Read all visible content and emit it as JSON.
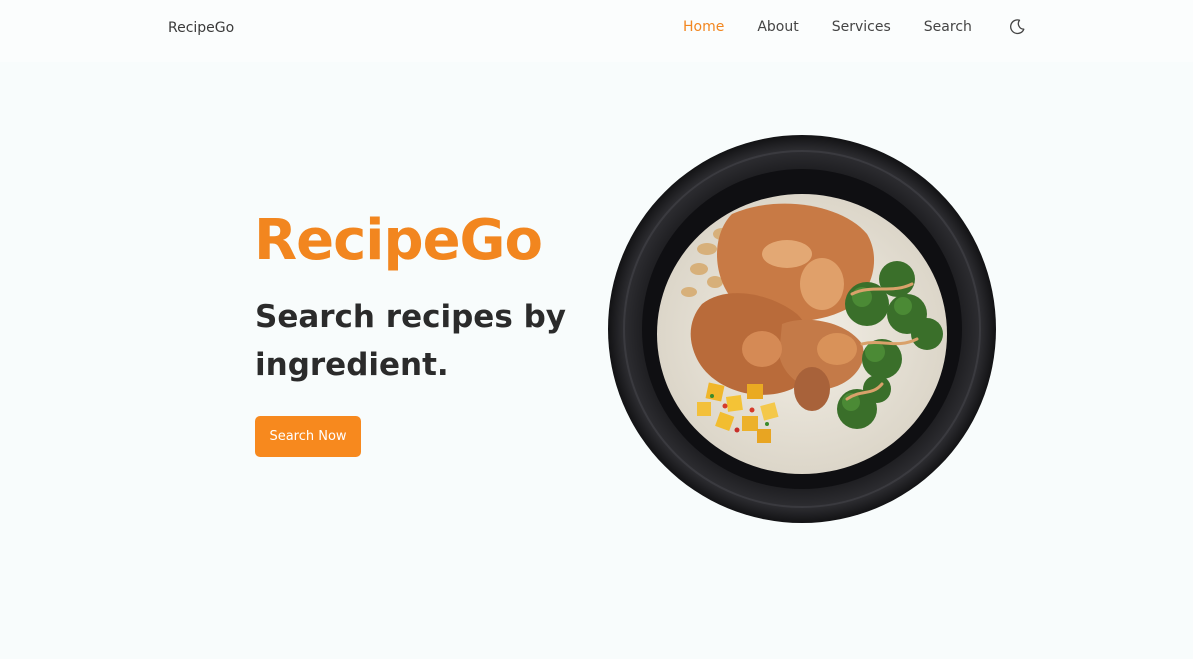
{
  "nav": {
    "brand": "RecipeGo",
    "links": [
      {
        "label": "Home",
        "active": true
      },
      {
        "label": "About",
        "active": false
      },
      {
        "label": "Services",
        "active": false
      },
      {
        "label": "Search",
        "active": false
      }
    ],
    "theme_icon": "moon-icon"
  },
  "hero": {
    "title": "RecipeGo",
    "subtitle": "Search recipes by ingredient.",
    "cta_label": "Search Now",
    "image_icon": "food-bowl-image"
  },
  "colors": {
    "accent": "#f2861f",
    "background": "#f8fcfc",
    "text_dark": "#2b2b2b"
  }
}
